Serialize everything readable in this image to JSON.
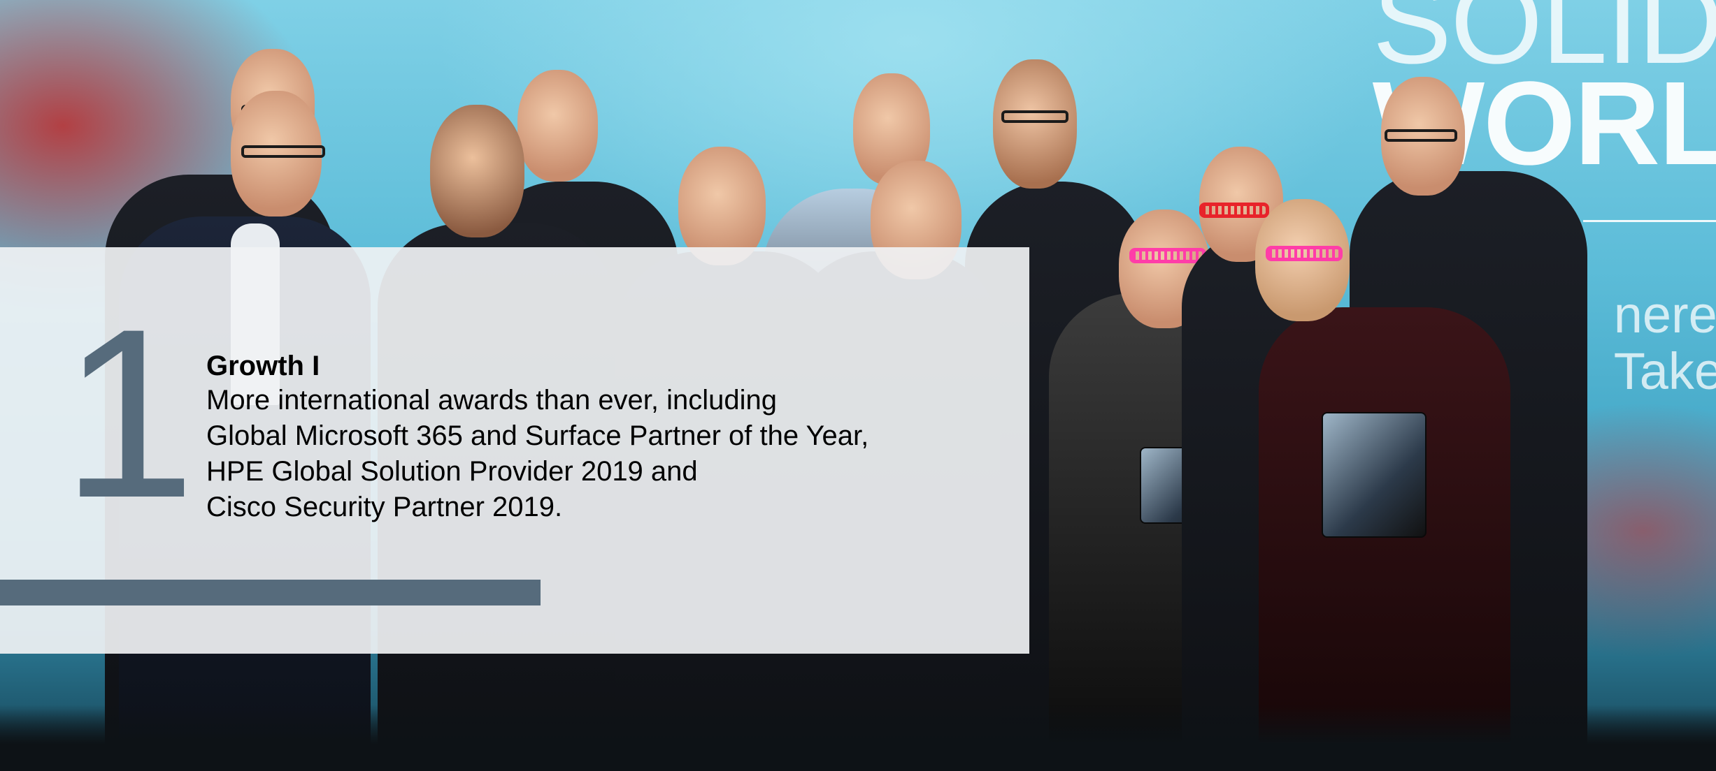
{
  "slide": {
    "number": "1",
    "heading": "Growth I",
    "lines": [
      "More international awards than ever, including",
      "Global Microsoft 365 and Surface Partner of the Year,",
      "HPE Global Solution Provider 2019 and",
      "Cisco Security Partner 2019."
    ]
  },
  "background": {
    "wall_text_lines": [
      "SOLID",
      "WORL"
    ],
    "wall_subtext_lines": [
      "nere",
      "Take"
    ],
    "accent_color": "#566b7c",
    "panel_color": "#f0f2f4"
  }
}
